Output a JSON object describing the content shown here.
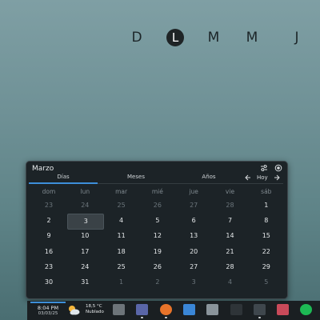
{
  "week_strip": {
    "days": [
      "D",
      "L",
      "M",
      "M",
      "J"
    ],
    "active_index": 1
  },
  "calendar": {
    "month_title": "Marzo",
    "icons": [
      "sliders-icon",
      "record-icon"
    ],
    "tabs": [
      {
        "label": "Días",
        "selected": true
      },
      {
        "label": "Meses",
        "selected": false
      },
      {
        "label": "Años",
        "selected": false
      }
    ],
    "nav": {
      "prev_icon": "chevron-left-icon",
      "today_label": "Hoy",
      "next_icon": "chevron-right-icon"
    },
    "weekday_headers": [
      "dom",
      "lun",
      "mar",
      "mié",
      "jue",
      "vie",
      "sáb"
    ],
    "weeks": [
      [
        {
          "d": "23",
          "out": true
        },
        {
          "d": "24",
          "out": true
        },
        {
          "d": "25",
          "out": true
        },
        {
          "d": "26",
          "out": true
        },
        {
          "d": "27",
          "out": true
        },
        {
          "d": "28",
          "out": true
        },
        {
          "d": "1",
          "out": false
        }
      ],
      [
        {
          "d": "2",
          "out": false
        },
        {
          "d": "3",
          "out": false,
          "today": true
        },
        {
          "d": "4",
          "out": false
        },
        {
          "d": "5",
          "out": false
        },
        {
          "d": "6",
          "out": false
        },
        {
          "d": "7",
          "out": false
        },
        {
          "d": "8",
          "out": false
        }
      ],
      [
        {
          "d": "9",
          "out": false
        },
        {
          "d": "10",
          "out": false
        },
        {
          "d": "11",
          "out": false
        },
        {
          "d": "12",
          "out": false
        },
        {
          "d": "13",
          "out": false
        },
        {
          "d": "14",
          "out": false
        },
        {
          "d": "15",
          "out": false
        }
      ],
      [
        {
          "d": "16",
          "out": false
        },
        {
          "d": "17",
          "out": false
        },
        {
          "d": "18",
          "out": false
        },
        {
          "d": "19",
          "out": false
        },
        {
          "d": "20",
          "out": false
        },
        {
          "d": "21",
          "out": false
        },
        {
          "d": "22",
          "out": false
        }
      ],
      [
        {
          "d": "23",
          "out": false
        },
        {
          "d": "24",
          "out": false
        },
        {
          "d": "25",
          "out": false
        },
        {
          "d": "26",
          "out": false
        },
        {
          "d": "27",
          "out": false
        },
        {
          "d": "28",
          "out": false
        },
        {
          "d": "29",
          "out": false
        }
      ],
      [
        {
          "d": "30",
          "out": false
        },
        {
          "d": "31",
          "out": false
        },
        {
          "d": "1",
          "out": true
        },
        {
          "d": "2",
          "out": true
        },
        {
          "d": "3",
          "out": true
        },
        {
          "d": "4",
          "out": true
        },
        {
          "d": "5",
          "out": true
        }
      ]
    ]
  },
  "taskbar": {
    "clock": {
      "time": "8:04 PM",
      "date": "03/03/25"
    },
    "weather": {
      "temp": "18,5 °C",
      "desc": "Nublado",
      "icon": "partly-cloudy-icon"
    },
    "apps": [
      {
        "name": "system-monitor-icon",
        "color": "#6d7479"
      },
      {
        "name": "file-manager-icon",
        "color": "#5a66a8"
      },
      {
        "name": "firefox-icon",
        "color": "#e8742a"
      },
      {
        "name": "folder-icon",
        "color": "#3a86d6"
      },
      {
        "name": "image-viewer-icon",
        "color": "#8a949b"
      },
      {
        "name": "terminal-icon",
        "color": "#2e3438"
      },
      {
        "name": "calculator-icon",
        "color": "#3f474d"
      },
      {
        "name": "document-viewer-icon",
        "color": "#c94a5a"
      },
      {
        "name": "spotify-icon",
        "color": "#1db954"
      }
    ],
    "accent": "#3d8fd9"
  }
}
